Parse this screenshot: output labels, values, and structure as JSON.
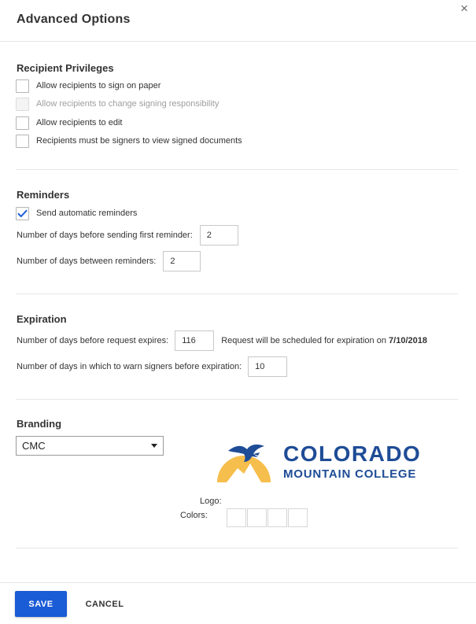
{
  "dialog": {
    "title": "Advanced Options",
    "close_icon": "×"
  },
  "recipient_privileges": {
    "title": "Recipient Privileges",
    "options": [
      {
        "label": "Allow recipients to sign on paper",
        "checked": false,
        "disabled": false
      },
      {
        "label": "Allow recipients to change signing responsibility",
        "checked": false,
        "disabled": true
      },
      {
        "label": "Allow recipients to edit",
        "checked": false,
        "disabled": false
      },
      {
        "label": "Recipients must be signers to view signed documents",
        "checked": false,
        "disabled": false
      }
    ]
  },
  "reminders": {
    "title": "Reminders",
    "auto_label": "Send automatic reminders",
    "auto_checked": true,
    "first_label": "Number of days before sending first reminder:",
    "first_value": "2",
    "between_label": "Number of days between reminders:",
    "between_value": "2"
  },
  "expiration": {
    "title": "Expiration",
    "expires_label": "Number of days before request expires:",
    "expires_value": "116",
    "note_prefix": "Request will be scheduled for expiration on",
    "note_date": "7/10/2018",
    "warn_label": "Number of days in which to warn signers before expiration:",
    "warn_value": "10"
  },
  "branding": {
    "title": "Branding",
    "selected": "CMC",
    "logo_line1": "COLORADO",
    "logo_line2": "MOUNTAIN COLLEGE",
    "logo_label": "Logo:",
    "colors_label": "Colors:"
  },
  "footer": {
    "save_label": "SAVE",
    "cancel_label": "CANCEL"
  },
  "colors": {
    "accent": "#1a5bd6",
    "logo_blue": "#1e4c96",
    "logo_gold": "#f6be4c"
  }
}
